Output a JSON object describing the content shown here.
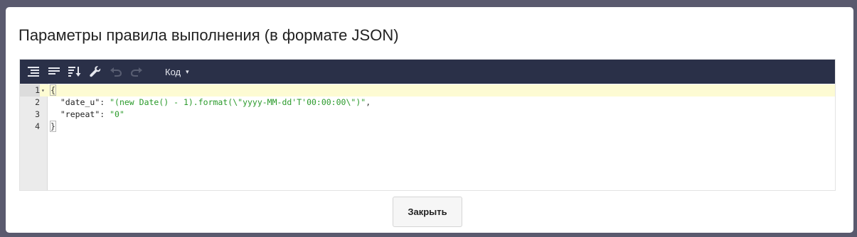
{
  "modal": {
    "title": "Параметры правила выполнения (в формате JSON)",
    "close_label": "Закрыть"
  },
  "toolbar": {
    "buttons": [
      {
        "icon": "format-icon",
        "enabled": true
      },
      {
        "icon": "compact-icon",
        "enabled": true
      },
      {
        "icon": "sort-icon",
        "enabled": true
      },
      {
        "icon": "wrench-icon",
        "enabled": true
      },
      {
        "icon": "undo-icon",
        "enabled": false
      },
      {
        "icon": "redo-icon",
        "enabled": false
      }
    ],
    "mode_label": "Код",
    "mode_caret": "▾"
  },
  "editor": {
    "line_numbers": [
      "1",
      "2",
      "3",
      "4"
    ],
    "active_line": 1,
    "lines": {
      "l1": "{",
      "l2_key": "\"date_u\"",
      "l2_colon": ": ",
      "l2_val_a": "\"(new Date() - 1).format(",
      "l2_esc_a": "\\\"",
      "l2_val_b": "yyyy-MM-dd'T'00:00:00",
      "l2_esc_b": "\\\"",
      "l2_val_c": ")\"",
      "l2_comma": ",",
      "l3_key": "\"repeat\"",
      "l3_colon": ": ",
      "l3_val": "\"0\"",
      "l4": "}"
    }
  },
  "colors": {
    "toolbar_bg": "#2a3048",
    "string": "#2a9a2a",
    "active_line": "#fdfbd3",
    "backdrop": "#5a5a6e"
  }
}
